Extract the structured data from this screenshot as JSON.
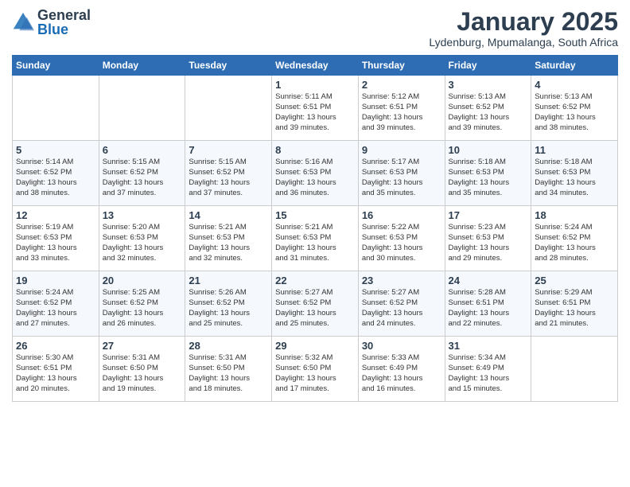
{
  "app": {
    "name": "GeneralBlue",
    "logo_general": "General",
    "logo_blue": "Blue"
  },
  "title": "January 2025",
  "subtitle": "Lydenburg, Mpumalanga, South Africa",
  "days_of_week": [
    "Sunday",
    "Monday",
    "Tuesday",
    "Wednesday",
    "Thursday",
    "Friday",
    "Saturday"
  ],
  "weeks": [
    [
      {
        "day": "",
        "content": ""
      },
      {
        "day": "",
        "content": ""
      },
      {
        "day": "",
        "content": ""
      },
      {
        "day": "1",
        "content": "Sunrise: 5:11 AM\nSunset: 6:51 PM\nDaylight: 13 hours\nand 39 minutes."
      },
      {
        "day": "2",
        "content": "Sunrise: 5:12 AM\nSunset: 6:51 PM\nDaylight: 13 hours\nand 39 minutes."
      },
      {
        "day": "3",
        "content": "Sunrise: 5:13 AM\nSunset: 6:52 PM\nDaylight: 13 hours\nand 39 minutes."
      },
      {
        "day": "4",
        "content": "Sunrise: 5:13 AM\nSunset: 6:52 PM\nDaylight: 13 hours\nand 38 minutes."
      }
    ],
    [
      {
        "day": "5",
        "content": "Sunrise: 5:14 AM\nSunset: 6:52 PM\nDaylight: 13 hours\nand 38 minutes."
      },
      {
        "day": "6",
        "content": "Sunrise: 5:15 AM\nSunset: 6:52 PM\nDaylight: 13 hours\nand 37 minutes."
      },
      {
        "day": "7",
        "content": "Sunrise: 5:15 AM\nSunset: 6:52 PM\nDaylight: 13 hours\nand 37 minutes."
      },
      {
        "day": "8",
        "content": "Sunrise: 5:16 AM\nSunset: 6:53 PM\nDaylight: 13 hours\nand 36 minutes."
      },
      {
        "day": "9",
        "content": "Sunrise: 5:17 AM\nSunset: 6:53 PM\nDaylight: 13 hours\nand 35 minutes."
      },
      {
        "day": "10",
        "content": "Sunrise: 5:18 AM\nSunset: 6:53 PM\nDaylight: 13 hours\nand 35 minutes."
      },
      {
        "day": "11",
        "content": "Sunrise: 5:18 AM\nSunset: 6:53 PM\nDaylight: 13 hours\nand 34 minutes."
      }
    ],
    [
      {
        "day": "12",
        "content": "Sunrise: 5:19 AM\nSunset: 6:53 PM\nDaylight: 13 hours\nand 33 minutes."
      },
      {
        "day": "13",
        "content": "Sunrise: 5:20 AM\nSunset: 6:53 PM\nDaylight: 13 hours\nand 32 minutes."
      },
      {
        "day": "14",
        "content": "Sunrise: 5:21 AM\nSunset: 6:53 PM\nDaylight: 13 hours\nand 32 minutes."
      },
      {
        "day": "15",
        "content": "Sunrise: 5:21 AM\nSunset: 6:53 PM\nDaylight: 13 hours\nand 31 minutes."
      },
      {
        "day": "16",
        "content": "Sunrise: 5:22 AM\nSunset: 6:53 PM\nDaylight: 13 hours\nand 30 minutes."
      },
      {
        "day": "17",
        "content": "Sunrise: 5:23 AM\nSunset: 6:53 PM\nDaylight: 13 hours\nand 29 minutes."
      },
      {
        "day": "18",
        "content": "Sunrise: 5:24 AM\nSunset: 6:52 PM\nDaylight: 13 hours\nand 28 minutes."
      }
    ],
    [
      {
        "day": "19",
        "content": "Sunrise: 5:24 AM\nSunset: 6:52 PM\nDaylight: 13 hours\nand 27 minutes."
      },
      {
        "day": "20",
        "content": "Sunrise: 5:25 AM\nSunset: 6:52 PM\nDaylight: 13 hours\nand 26 minutes."
      },
      {
        "day": "21",
        "content": "Sunrise: 5:26 AM\nSunset: 6:52 PM\nDaylight: 13 hours\nand 25 minutes."
      },
      {
        "day": "22",
        "content": "Sunrise: 5:27 AM\nSunset: 6:52 PM\nDaylight: 13 hours\nand 25 minutes."
      },
      {
        "day": "23",
        "content": "Sunrise: 5:27 AM\nSunset: 6:52 PM\nDaylight: 13 hours\nand 24 minutes."
      },
      {
        "day": "24",
        "content": "Sunrise: 5:28 AM\nSunset: 6:51 PM\nDaylight: 13 hours\nand 22 minutes."
      },
      {
        "day": "25",
        "content": "Sunrise: 5:29 AM\nSunset: 6:51 PM\nDaylight: 13 hours\nand 21 minutes."
      }
    ],
    [
      {
        "day": "26",
        "content": "Sunrise: 5:30 AM\nSunset: 6:51 PM\nDaylight: 13 hours\nand 20 minutes."
      },
      {
        "day": "27",
        "content": "Sunrise: 5:31 AM\nSunset: 6:50 PM\nDaylight: 13 hours\nand 19 minutes."
      },
      {
        "day": "28",
        "content": "Sunrise: 5:31 AM\nSunset: 6:50 PM\nDaylight: 13 hours\nand 18 minutes."
      },
      {
        "day": "29",
        "content": "Sunrise: 5:32 AM\nSunset: 6:50 PM\nDaylight: 13 hours\nand 17 minutes."
      },
      {
        "day": "30",
        "content": "Sunrise: 5:33 AM\nSunset: 6:49 PM\nDaylight: 13 hours\nand 16 minutes."
      },
      {
        "day": "31",
        "content": "Sunrise: 5:34 AM\nSunset: 6:49 PM\nDaylight: 13 hours\nand 15 minutes."
      },
      {
        "day": "",
        "content": ""
      }
    ]
  ]
}
